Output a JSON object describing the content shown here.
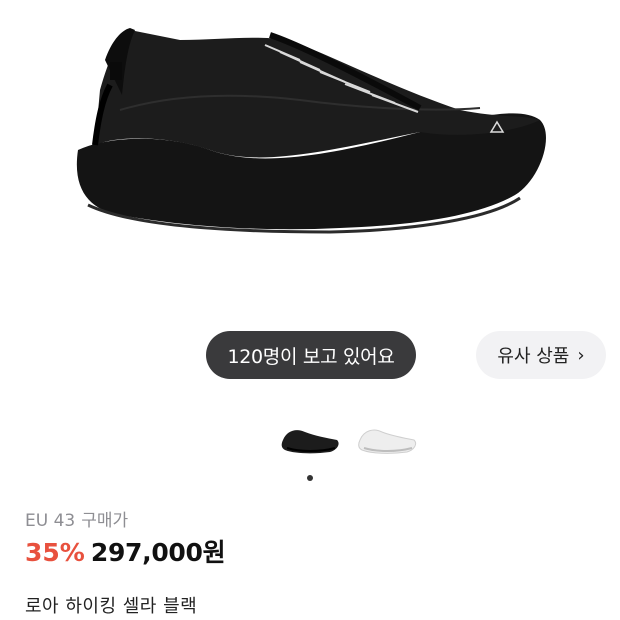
{
  "product_image": {
    "alt": "black hiking shoe",
    "color": "#151515"
  },
  "viewers_pill": {
    "label": "120명이 보고 있어요"
  },
  "similar_button": {
    "label": "유사 상품",
    "icon": "chevron-right-icon"
  },
  "thumbnails": [
    {
      "label": "black variant",
      "color": "#1c1c1c",
      "selected": true
    },
    {
      "label": "white variant",
      "color": "#eeeeee",
      "selected": false
    }
  ],
  "pagination": {
    "current": 1,
    "total": 1
  },
  "product": {
    "size": "EU 43",
    "price_type": "구매가",
    "discount": "35%",
    "price": "297,000원",
    "name": "로아 하이킹 셀라 블랙"
  },
  "colors": {
    "discount": "#e8513e",
    "pill_dark": "#3a3a3c",
    "pill_light": "#f2f2f4"
  }
}
